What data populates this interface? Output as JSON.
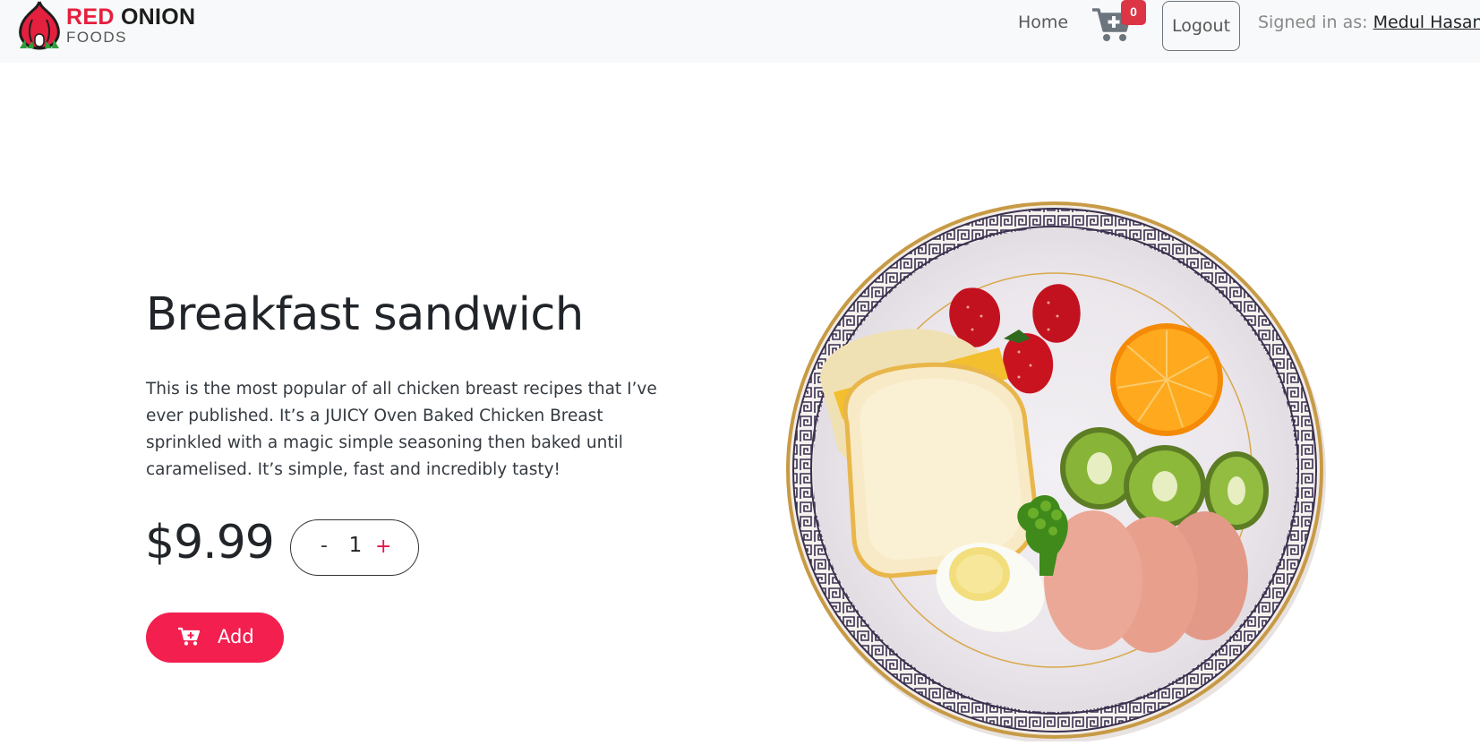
{
  "navbar": {
    "brand": {
      "name_part1": "RED",
      "name_part2": "ONION",
      "subtitle": "FOODS"
    },
    "home_label": "Home",
    "cart_count": "0",
    "logout_label": "Logout",
    "signed_in_prefix": "Signed in as: ",
    "user_name": "Medul Hasan"
  },
  "product": {
    "title": "Breakfast sandwich",
    "description": "This is the most popular of all chicken breast recipes that I’ve ever published. It’s a JUICY Oven Baked Chicken Breast sprinkled with a magic simple seasoning then baked until caramelised. It’s simple, fast and incredibly tasty!",
    "price": "$9.99",
    "quantity": "1",
    "minus_label": "-",
    "plus_label": "+",
    "add_label": "Add"
  },
  "colors": {
    "accent": "#f31f4f",
    "badge": "#dc3545",
    "navbar_bg": "#f8f9fa"
  }
}
